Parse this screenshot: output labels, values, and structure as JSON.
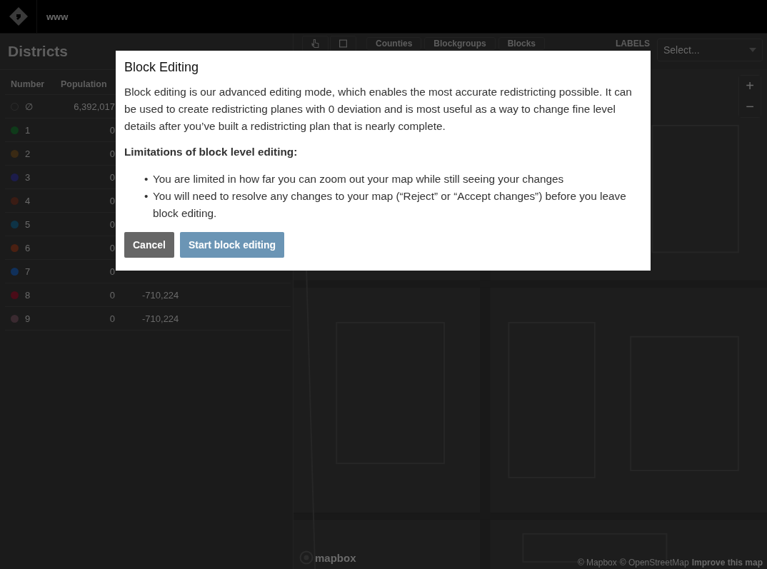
{
  "app_bar": {
    "title": "www"
  },
  "sidebar": {
    "title": "Districts",
    "columns": [
      "Number",
      "Population"
    ],
    "rows": [
      {
        "number": "∅",
        "population": "6,392,017"
      },
      {
        "number": "1",
        "population": "0",
        "color": "#0f3a1a"
      },
      {
        "number": "2",
        "population": "0",
        "color": "#3a2a14"
      },
      {
        "number": "3",
        "population": "0",
        "color": "#1c1c4a"
      },
      {
        "number": "4",
        "population": "0",
        "color": "#3a1c14"
      },
      {
        "number": "5",
        "population": "0",
        "color": "#0e3346"
      },
      {
        "number": "6",
        "population": "0",
        "color": "#4a2012"
      },
      {
        "number": "7",
        "population": "0",
        "color": "#10305a"
      },
      {
        "number": "8",
        "population": "0",
        "column_3": "-710,224",
        "color": "#4a0c18"
      },
      {
        "number": "9",
        "population": "0",
        "column_3": "-710,224",
        "color": "#3a2a30"
      }
    ]
  },
  "toolbar": {
    "tools": [
      {
        "kind": "hand"
      },
      {
        "kind": "rectangle"
      }
    ],
    "layers": [
      {
        "label": "Counties"
      },
      {
        "label": "Blockgroups"
      },
      {
        "label": "Blocks"
      }
    ],
    "labels_label": "LABELS",
    "select": {
      "placeholder": "Select..."
    }
  },
  "map": {
    "zoom_in": "+",
    "zoom_out": "−",
    "logo_text": "mapbox",
    "attribution": [
      "© Mapbox",
      "© OpenStreetMap"
    ],
    "improve_link": "Improve this map"
  },
  "dialog": {
    "title": "Block Editing",
    "body": "Block editing is our advanced editing mode, which enables the most accurate redistricting possible. It can be used to create redistricting planes with 0 deviation and is most useful as a way to change fine level details after you’ve built a redistricting plan that is nearly complete.",
    "subheading": "Limitations of block level editing:",
    "bullet_mark": "•",
    "bullets": [
      "You are limited in how far you can zoom out your map while still seeing your changes",
      "You will need to resolve any changes to your map (“Reject” or “Accept changes”) before you leave block editing."
    ],
    "buttons": [
      {
        "label": "Cancel",
        "kind": "secondary"
      },
      {
        "label": "Start block editing",
        "kind": "primary"
      }
    ]
  }
}
